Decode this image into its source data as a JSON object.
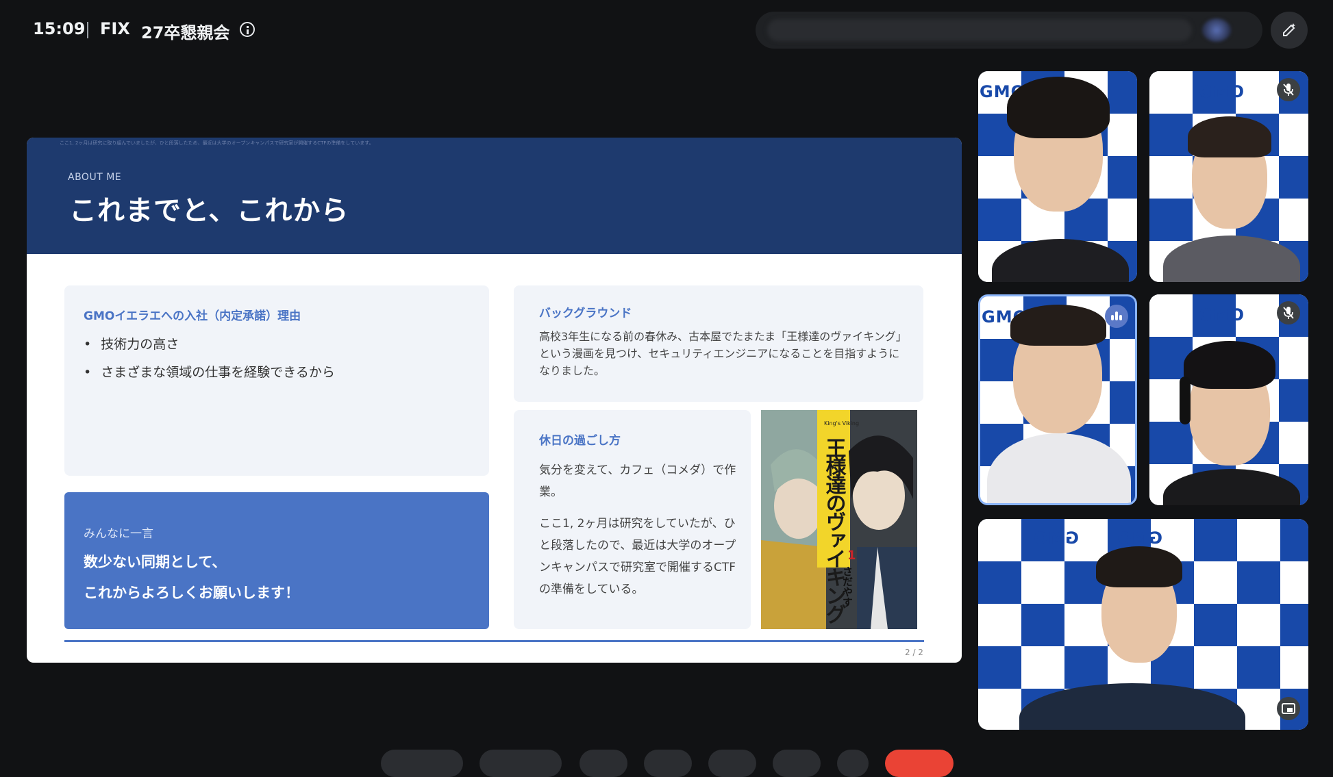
{
  "topbar": {
    "time": "15:09",
    "meeting_code": "FIX",
    "meeting_title": "27卒懇親会",
    "info_icon": "info-icon",
    "edit_icon": "pen-sparkle-icon"
  },
  "slide": {
    "top_small_text": "ここ1, 2ヶ月は研究に取り組んでいましたが、ひと段落したため、最近は大学のオープンキャンパスで研究室が開催するCTFの準備をしています。",
    "eyebrow": "ABOUT ME",
    "title": "これまでと、これから",
    "reason": {
      "title": "GMOイエラエへの入社（内定承諾）理由",
      "items": [
        "技術力の高さ",
        "さまざまな領域の仕事を経験できるから"
      ]
    },
    "message": {
      "label": "みんなに一言",
      "line1": "数少ない同期として、",
      "line2": "これからよろしくお願いします！"
    },
    "background": {
      "title": "バックグラウンド",
      "body": "高校3年生になる前の春休み、古本屋でたまたま「王様達のヴァイキング」という漫画を見つけ、セキュリティエンジニアになることを目指すようになりました。"
    },
    "holiday": {
      "title": "休日の過ごし方",
      "p1": "気分を変えて、カフェ（コメダ）で作業。",
      "p2": "ここ1, 2ヶ月は研究をしていたが、ひと段落したので、最近は大学のオープンキャンパスで研究室で開催するCTFの準備をしている。"
    },
    "manga_title": "王様達のヴァイキング",
    "manga_author": "さだやす",
    "manga_volume": "1",
    "manga_subtitle": "King's Viking",
    "page_number": "2 / 2"
  },
  "participants": {
    "logo_text": "GMO",
    "tiles": [
      {
        "id": "p1",
        "muted": false
      },
      {
        "id": "p2",
        "muted": true
      },
      {
        "id": "p3",
        "speaking": true
      },
      {
        "id": "p4",
        "muted": true
      },
      {
        "id": "p5",
        "pinned": true
      }
    ]
  },
  "colors": {
    "background": "#111214",
    "slide_header": "#1e3a6e",
    "accent": "#4a74c5",
    "gmo_blue": "#1849a9"
  }
}
